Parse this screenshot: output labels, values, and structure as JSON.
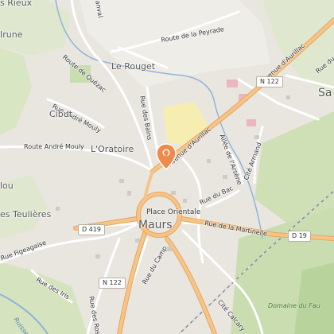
{
  "map": {
    "labels": {
      "route_de_la_peyrade": "Route de la Peyrade",
      "le_rouget": "Le Rouget",
      "route_de_quezac": "Route de Quézac",
      "route_andre_mouly_top": "Rue André Mouly",
      "cibut": "Cibut",
      "route_andre_mouly": "Route André Mouly",
      "l_oratoire": "L'Oratoire",
      "rue_des_bains": "Rue des Bains",
      "avenue_aurillac_center": "Avenue d'Aurillac",
      "avenue_aurillac_ne": "Avenue d'Aurillac",
      "allee_arsene": "Allée de l'Arsène",
      "cite_armand": "Cité Armand",
      "rue_du_bac": "Rue du Bac",
      "place_orientale": "Place Orientale",
      "maurs": "Maurs",
      "les_teulieres": "es Teulières",
      "rue_de_la_martinelle": "Rue de la Martinelle",
      "rue_figeagaise": "Rue Figeagaise",
      "rue_du_camp": "Rue du Camp",
      "rue_des_iris": "Rue des Iris",
      "rue_des_roses": "Rue des Roses",
      "cite_calcary": "Cité Calcary",
      "domaine_du_fau": "Domaine du Fau",
      "ruisseau": "Ruisseau",
      "les_rieux": "s Rieux",
      "rune": "Irune",
      "lou": "lou",
      "sa": "Sa",
      "rue_du_sa": "Rue du Sa",
      "anval": "anval"
    },
    "road_shields": {
      "n122_top": "N 122",
      "n122_bottom": "N 122",
      "d419": "D 419",
      "d19": "D 19"
    },
    "colors": {
      "background": "#e9e6e0",
      "major_road": "#f2b872",
      "minor_road": "#ffffff",
      "forest": "#c9ddb0",
      "field": "#dfe8cf",
      "water": "#8eb4d8",
      "marker": "#f08a4b",
      "railway": "#8a8a8a"
    },
    "marker": {
      "icon": "location-pin-icon"
    }
  }
}
